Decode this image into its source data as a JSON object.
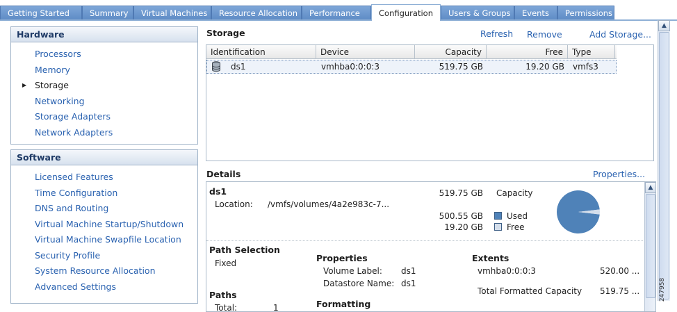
{
  "tabs": [
    {
      "label": "Getting Started",
      "active": false
    },
    {
      "label": "Summary",
      "active": false
    },
    {
      "label": "Virtual Machines",
      "active": false
    },
    {
      "label": "Resource Allocation",
      "active": false
    },
    {
      "label": "Performance",
      "active": false
    },
    {
      "label": "Configuration",
      "active": true
    },
    {
      "label": "Users & Groups",
      "active": false
    },
    {
      "label": "Events",
      "active": false
    },
    {
      "label": "Permissions",
      "active": false
    }
  ],
  "hardware": {
    "title": "Hardware",
    "items": [
      "Processors",
      "Memory",
      "Storage",
      "Networking",
      "Storage Adapters",
      "Network Adapters"
    ],
    "selected": "Storage"
  },
  "software": {
    "title": "Software",
    "items": [
      "Licensed Features",
      "Time Configuration",
      "DNS and Routing",
      "Virtual Machine Startup/Shutdown",
      "Virtual Machine Swapfile Location",
      "Security Profile",
      "System Resource Allocation",
      "Advanced Settings"
    ]
  },
  "storage": {
    "title": "Storage",
    "actions": {
      "refresh": "Refresh",
      "remove": "Remove",
      "add": "Add Storage..."
    },
    "columns": [
      "Identification",
      "Device",
      "Capacity",
      "Free",
      "Type"
    ],
    "rows": [
      {
        "identification": "ds1",
        "device": "vmhba0:0:0:3",
        "capacity": "519.75 GB",
        "free": "19.20 GB",
        "type": "vmfs3"
      }
    ]
  },
  "details": {
    "title": "Details",
    "properties_link": "Properties...",
    "name": "ds1",
    "location_label": "Location:",
    "location_value": "/vmfs/volumes/4a2e983c-7...",
    "capacity_value": "519.75 GB",
    "capacity_label": "Capacity",
    "used_value": "500.55 GB",
    "used_label": "Used",
    "free_value": "19.20 GB",
    "free_label": "Free",
    "used_fraction": 0.963,
    "used_color": "#4f82b8",
    "free_color": "#d4deeb",
    "path_selection": {
      "title": "Path Selection",
      "value": "Fixed"
    },
    "properties": {
      "title": "Properties",
      "volume_label_key": "Volume Label:",
      "volume_label_value": "ds1",
      "datastore_name_key": "Datastore Name:",
      "datastore_name_value": "ds1"
    },
    "extents": {
      "title": "Extents",
      "device": "vmhba0:0:0:3",
      "device_size": "520.00 ...",
      "total_label": "Total Formatted Capacity",
      "total_value": "519.75 ..."
    },
    "paths": {
      "title": "Paths",
      "total_label": "Total:",
      "total_value": "1"
    },
    "formatting": {
      "title": "Formatting"
    }
  },
  "side_id": "247958"
}
